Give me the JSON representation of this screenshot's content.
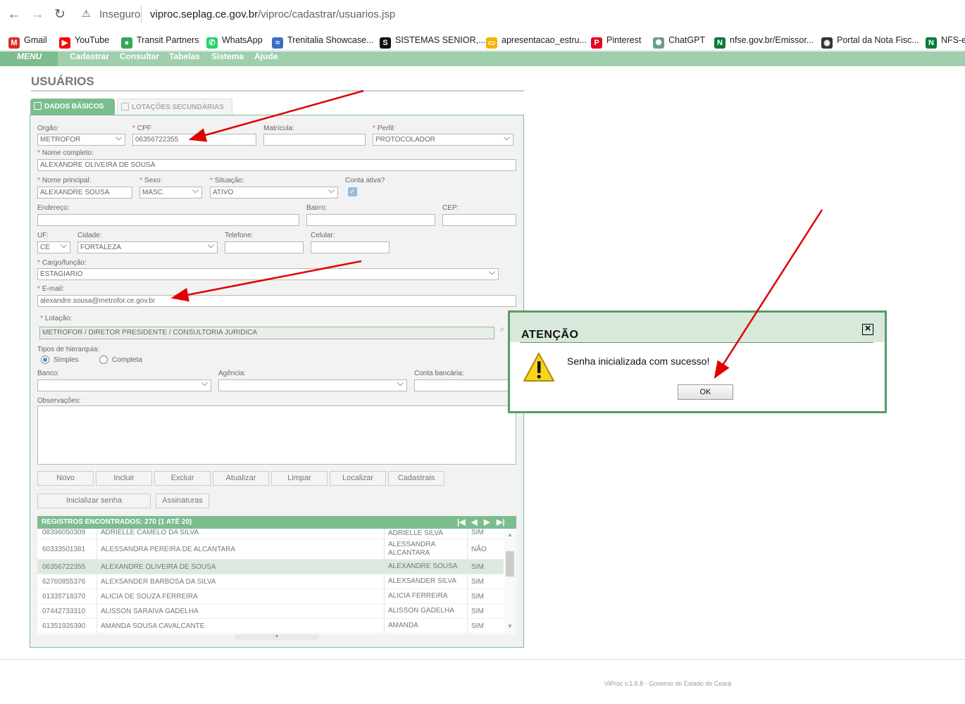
{
  "browser": {
    "security_label": "Inseguro",
    "url_host": "viproc.seplag.ce.gov.br",
    "url_path": "/viproc/cadastrar/usuarios.jsp",
    "bookmarks": [
      {
        "label": "Gmail",
        "icon": "gmail-icon",
        "color": "#d93025"
      },
      {
        "label": "YouTube",
        "icon": "youtube-icon",
        "color": "#ff0000"
      },
      {
        "label": "Transit Partners",
        "icon": "maps-pin-icon",
        "color": "#34a853"
      },
      {
        "label": "WhatsApp",
        "icon": "whatsapp-icon",
        "color": "#25d366"
      },
      {
        "label": "Trenitalia Showcase...",
        "icon": "trenitalia-icon",
        "color": "#3a6fc4"
      },
      {
        "label": "SISTEMAS SENIOR,...",
        "icon": "senior-icon",
        "color": "#111111"
      },
      {
        "label": "apresentacao_estru...",
        "icon": "slides-icon",
        "color": "#f4b400"
      },
      {
        "label": "Pinterest",
        "icon": "pinterest-icon",
        "color": "#e60023"
      },
      {
        "label": "ChatGPT",
        "icon": "chatgpt-icon",
        "color": "#6b9e8a"
      },
      {
        "label": "nfse.gov.br/Emissor...",
        "icon": "nfse-icon",
        "color": "#0a7a3a"
      },
      {
        "label": "Portal da Nota Fisc...",
        "icon": "globe-icon",
        "color": "#333333"
      },
      {
        "label": "NFS-e",
        "icon": "nfse-icon",
        "color": "#0a7a3a"
      }
    ]
  },
  "menu": {
    "home": "MENU",
    "items": [
      "Cadastrar",
      "Consultar",
      "Tabelas",
      "Sistema",
      "Ajuda"
    ]
  },
  "page": {
    "title": "USUÁRIOS",
    "tabs": [
      "DADOS BÁSICOS",
      "LOTAÇÕES SECUNDÁRIAS"
    ]
  },
  "form": {
    "orgao": {
      "label": "Orgão:",
      "value": "METROFOR"
    },
    "cpf": {
      "label": "CPF",
      "value": "06356722355"
    },
    "matricula": {
      "label": "Matrícula:",
      "value": ""
    },
    "perfil": {
      "label": "Perfil:",
      "value": "PROTOCOLADOR"
    },
    "nome_completo": {
      "label": "Nome completo:",
      "value": "ALEXANDRE OLIVEIRA DE SOUSA"
    },
    "nome_principal": {
      "label": "Nome principal:",
      "value": "ALEXANDRE SOUSA"
    },
    "sexo": {
      "label": "Sexo:",
      "value": "MASC."
    },
    "situacao": {
      "label": "Situação:",
      "value": "ATIVO"
    },
    "conta_ativa": {
      "label": "Conta ativa?",
      "checked": true
    },
    "endereco": {
      "label": "Endereço:",
      "value": ""
    },
    "bairro": {
      "label": "Bairro:",
      "value": ""
    },
    "cep": {
      "label": "CEP:",
      "value": ""
    },
    "uf": {
      "label": "UF:",
      "value": "CE"
    },
    "cidade": {
      "label": "Cidade:",
      "value": "FORTALEZA"
    },
    "telefone": {
      "label": "Telefone:",
      "value": ""
    },
    "celular": {
      "label": "Celular:",
      "value": ""
    },
    "cargo": {
      "label": "Cargo/função:",
      "value": "ESTAGIARIO"
    },
    "email": {
      "label": "E-mail:",
      "value": "alexandre.sousa@metrofor.ce.gov.br"
    },
    "lotacao": {
      "label": "Lotação:",
      "value": "METROFOR / DIRETOR PRESIDENTE / CONSULTORIA JURIDICA"
    },
    "hierarquia": {
      "label": "Tipos de hierarquia:",
      "options": [
        "Simples",
        "Completa"
      ],
      "selected": "Simples"
    },
    "banco": {
      "label": "Banco:",
      "value": ""
    },
    "agencia": {
      "label": "Agência:",
      "value": ""
    },
    "conta_bancaria": {
      "label": "Conta bancária:",
      "value": ""
    },
    "observacoes": {
      "label": "Observações:",
      "value": ""
    }
  },
  "buttons": {
    "row1": [
      "Novo",
      "Incluir",
      "Excluir",
      "Atualizar",
      "Limpar",
      "Localizar",
      "Cadastrais"
    ],
    "row2": [
      "Inicializar senha",
      "Assinaturas"
    ]
  },
  "grid": {
    "header": "REGISTROS ENCONTRADOS: 270 (1 ATÉ 20)",
    "rows": [
      {
        "cpf": "08396050309",
        "nome": "ADRIELLE CAMELO DA SILVA",
        "principal": "ADRIELLE SILVA",
        "ativo": "SIM"
      },
      {
        "cpf": "60333501381",
        "nome": "ALESSANDRA PEREIRA DE ALCANTARA",
        "principal": "ALESSANDRA ALCANTARA",
        "ativo": "NÃO"
      },
      {
        "cpf": "06356722355",
        "nome": "ALEXANDRE OLIVEIRA DE SOUSA",
        "principal": "ALEXANDRE SOUSA",
        "ativo": "SIM"
      },
      {
        "cpf": "62760855376",
        "nome": "ALEXSANDER BARBOSA DA SILVA",
        "principal": "ALEXSANDER SILVA",
        "ativo": "SIM"
      },
      {
        "cpf": "61335718370",
        "nome": "ALICIA DE SOUZA FERREIRA",
        "principal": "ALICIA FERREIRA",
        "ativo": "SIM"
      },
      {
        "cpf": "07442733310",
        "nome": "ALISSON SARAIVA GADELHA",
        "principal": "ALISSON GADELHA",
        "ativo": "SIM"
      },
      {
        "cpf": "61351926390",
        "nome": "AMANDA SOUSA CAVALCANTE",
        "principal": "AMANDA",
        "ativo": "SIM"
      }
    ]
  },
  "footer": "ViProc v.1.6.8 - Governo do Estado do Ceará",
  "dialog": {
    "title": "ATENÇÃO",
    "message": "Senha inicializada com sucesso!",
    "ok_label": "OK"
  },
  "colors": {
    "accent": "#7bbd8d",
    "arrow": "#e00000",
    "dialog_border": "#5a9a6d"
  }
}
